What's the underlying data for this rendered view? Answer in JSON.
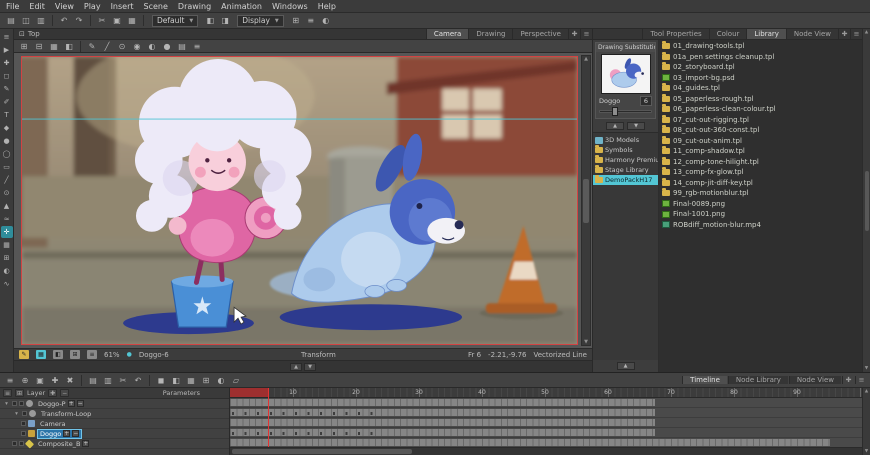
{
  "menu": {
    "items": [
      "File",
      "Edit",
      "View",
      "Play",
      "Insert",
      "Scene",
      "Drawing",
      "Animation",
      "Windows",
      "Help"
    ]
  },
  "toolbar": {
    "preset": "Default",
    "display": "Display"
  },
  "camera": {
    "view_label": "Top",
    "tabs": [
      "Camera",
      "Drawing",
      "Perspective"
    ],
    "status": {
      "zoom": "61%",
      "drawing_name": "Doggo-6",
      "tool": "Transform",
      "frame": "Fr 6",
      "coords": "-2.21,-9.76",
      "line_mode": "Vectorized Line"
    }
  },
  "right_panel": {
    "tabs": [
      "Tool Properties",
      "Colour",
      "Library",
      "Node View"
    ],
    "substitution": {
      "title": "Drawing Substitution",
      "layer_name": "Doggo",
      "value": "6"
    },
    "tree": [
      "3D Models",
      "Symbols",
      "Harmony Premium ...",
      "Stage Library",
      "DemoPackH17"
    ],
    "files": [
      "01_drawing-tools.tpl",
      "01a_pen settings cleanup.tpl",
      "02_storyboard.tpl",
      "03_import-bg.psd",
      "04_guides.tpl",
      "05_paperless-rough.tpl",
      "06_paperless-clean-colour.tpl",
      "07_cut-out-rigging.tpl",
      "08_cut-out-360-const.tpl",
      "09_cut-out-anim.tpl",
      "11_comp-shadow.tpl",
      "12_comp-tone-hilight.tpl",
      "13_comp-fx-glow.tpl",
      "14_comp-jit-diff-key.tpl",
      "99_rgb-motionblur.tpl",
      "Final-0089.png",
      "Final-1001.png",
      "ROBdiff_motion-blur.mp4"
    ]
  },
  "timeline": {
    "tabs": [
      "Timeline",
      "Node Library",
      "Node View"
    ],
    "layer_header": "Layer",
    "parameters_header": "Parameters",
    "layers": [
      "Doggo-P",
      "Transform-Loop",
      "Camera",
      "Doggo",
      "Composite_B"
    ],
    "ruler_marks": [
      "10",
      "20",
      "30",
      "40",
      "50",
      "60",
      "70",
      "80",
      "90"
    ]
  },
  "colors": {
    "accent_teal": "#53c6d4",
    "camera_frame_red": "#d24343",
    "playhead_red": "#e23434",
    "selection_blue": "#2b74a8",
    "folder_yellow": "#d8b44a"
  }
}
